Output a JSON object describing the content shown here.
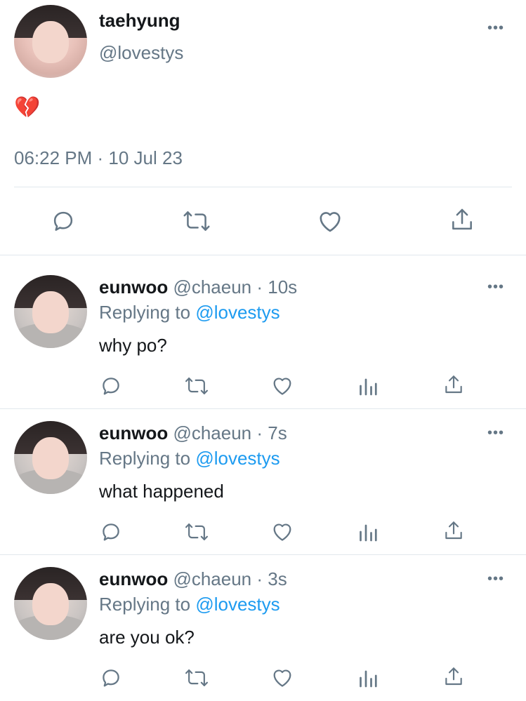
{
  "tweet": {
    "display_name": "taehyung",
    "handle": "@lovestys",
    "content_emoji": "💔",
    "timestamp": "06:22 PM · 10 Jul 23",
    "more": "•••"
  },
  "replies": [
    {
      "display_name": "eunwoo",
      "handle_time": "@chaeun · 10s",
      "replying_prefix": "Replying to",
      "replying_to": "@lovestys",
      "text": "why po?",
      "more": "•••"
    },
    {
      "display_name": "eunwoo",
      "handle_time": "@chaeun · 7s",
      "replying_prefix": "Replying to",
      "replying_to": "@lovestys",
      "text": "what happened",
      "more": "•••"
    },
    {
      "display_name": "eunwoo",
      "handle_time": "@chaeun · 3s",
      "replying_prefix": "Replying to",
      "replying_to": "@lovestys",
      "text": "are you ok?",
      "more": "•••"
    }
  ],
  "icons": {
    "reply": "reply-icon",
    "retweet": "retweet-icon",
    "like": "heart-icon",
    "views": "analytics-icon",
    "share": "share-icon",
    "more": "more-icon"
  },
  "colors": {
    "text": "#14171a",
    "muted": "#657786",
    "link": "#1d9bf0",
    "divider": "#e1e8ed"
  }
}
